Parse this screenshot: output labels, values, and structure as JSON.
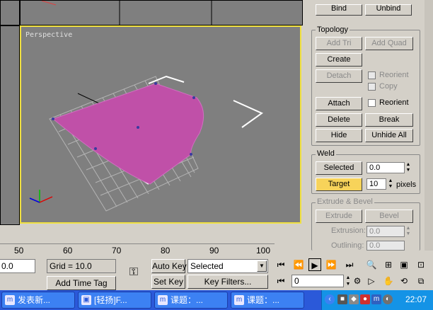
{
  "viewport": {
    "label": "Perspective"
  },
  "panel": {
    "top_buttons": {
      "bind": "Bind",
      "unbind": "Unbind"
    },
    "topology": {
      "title": "Topology",
      "add_tri": "Add Tri",
      "add_quad": "Add Quad",
      "create": "Create",
      "detach": "Detach",
      "reorient": "Reorient",
      "copy": "Copy",
      "attach": "Attach",
      "reorient2": "Reorient",
      "delete": "Delete",
      "break": "Break",
      "hide": "Hide",
      "unhide_all": "Unhide All"
    },
    "weld": {
      "title": "Weld",
      "selected": "Selected",
      "selected_value": "0.0",
      "target": "Target",
      "target_value": "10",
      "pixels": "pixels"
    },
    "extrude": {
      "title": "Extrude & Bevel",
      "extrude": "Extrude",
      "bevel": "Bevel",
      "extrusion_label": "Extrusion:",
      "extrusion_value": "0.0",
      "outlining_label": "Outlining:",
      "outlining_value": "0.0"
    }
  },
  "ruler": {
    "ticks": [
      "50",
      "60",
      "70",
      "80",
      "90",
      "100"
    ]
  },
  "bottom": {
    "coord_value": "0.0",
    "grid": "Grid = 10.0",
    "add_time_tag": "Add Time Tag",
    "auto_key": "Auto Key",
    "set_key": "Set Key",
    "selected_option": "Selected",
    "key_filters": "Key Filters...",
    "frame_value": "0"
  },
  "taskbar": {
    "tasks": [
      "发表新...",
      "[轻扬]F...",
      "课题：...",
      "课题：..."
    ],
    "clock": "22:07"
  },
  "colors": {
    "viewport_border": "#f0e040",
    "mesh": "#c050a8",
    "target_highlight": "#f7d35a",
    "taskbar": "#2b59d9"
  }
}
